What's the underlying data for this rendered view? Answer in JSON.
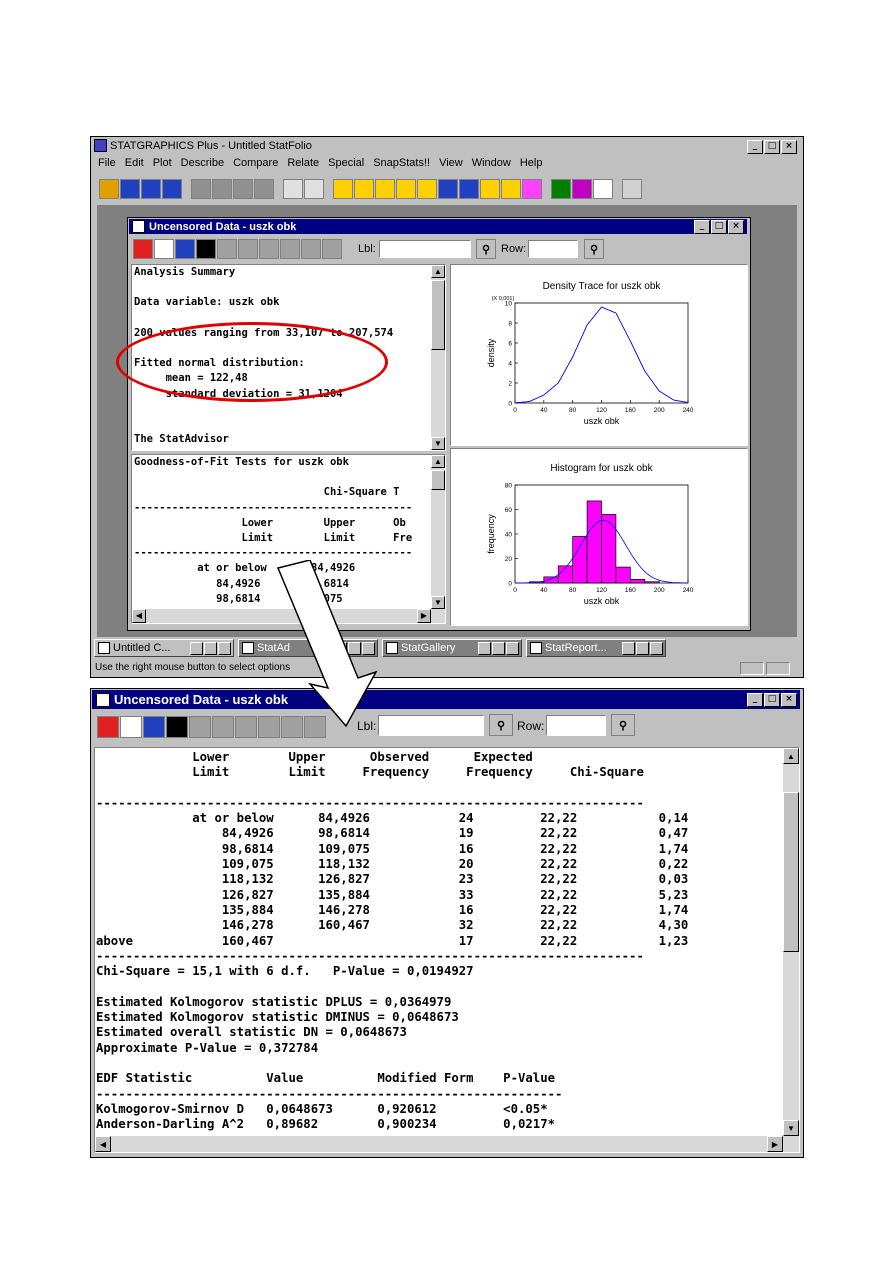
{
  "app": {
    "title": "STATGRAPHICS Plus - Untitled StatFolio",
    "menu": [
      "File",
      "Edit",
      "Plot",
      "Describe",
      "Compare",
      "Relate",
      "Special",
      "SnapStats!!",
      "View",
      "Window",
      "Help"
    ],
    "status": "Use the right mouse button to select options"
  },
  "inner_window": {
    "title": "Uncensored Data - uszk obk",
    "lbl": "Lbl:",
    "row": "Row:",
    "summary_lines": [
      "Analysis Summary",
      "",
      "Data variable: uszk obk",
      "",
      "200 values ranging from 33,107 to 207,574",
      "",
      "Fitted normal distribution:",
      "     mean = 122,48",
      "     standard deviation = 31,1204",
      "",
      "",
      "The StatAdvisor"
    ],
    "gof_lines": [
      "Goodness-of-Fit Tests for uszk obk",
      "",
      "                              Chi-Square T",
      "--------------------------------------------",
      "                 Lower        Upper      Ob",
      "                 Limit        Limit      Fre",
      "--------------------------------------------",
      "          at or below       84,4926",
      "             84,4926       98,6814",
      "             98,6814      109,075"
    ]
  },
  "density_chart": {
    "title": "Density Trace for uszk obk",
    "multiplier": "(X 0,001)",
    "xlabel": "uszk obk",
    "ylabel": "density",
    "xticks": [
      "0",
      "40",
      "80",
      "120",
      "160",
      "200",
      "240"
    ],
    "yticks": [
      "0",
      "2",
      "4",
      "6",
      "8",
      "10"
    ]
  },
  "histogram_chart": {
    "title": "Histogram for uszk obk",
    "xlabel": "uszk obk",
    "ylabel": "frequency",
    "xticks": [
      "0",
      "40",
      "80",
      "120",
      "160",
      "200",
      "240"
    ],
    "yticks": [
      "0",
      "20",
      "40",
      "60",
      "80"
    ]
  },
  "chart_data": [
    {
      "type": "line",
      "title": "Density Trace for uszk obk",
      "xlabel": "uszk obk",
      "ylabel": "density",
      "xlim": [
        0,
        240
      ],
      "ylim": [
        0,
        10
      ],
      "x": [
        0,
        20,
        40,
        60,
        80,
        100,
        120,
        140,
        160,
        180,
        200,
        220,
        240
      ],
      "values": [
        0.02,
        0.15,
        0.8,
        2.0,
        4.6,
        7.8,
        9.6,
        9.0,
        6.2,
        3.2,
        1.2,
        0.3,
        0.05
      ]
    },
    {
      "type": "bar",
      "title": "Histogram for uszk obk",
      "xlabel": "uszk obk",
      "ylabel": "frequency",
      "xlim": [
        0,
        240
      ],
      "ylim": [
        0,
        80
      ],
      "bin_edges": [
        20,
        40,
        60,
        80,
        100,
        120,
        140,
        160,
        180,
        200
      ],
      "values": [
        1,
        5,
        14,
        38,
        67,
        56,
        13,
        3,
        1
      ]
    }
  ],
  "taskbar": [
    {
      "label": "Untitled C...",
      "color": "#c0c0c0"
    },
    {
      "label": "StatAd",
      "color": "#808080"
    },
    {
      "label": "StatGallery",
      "color": "#808080"
    },
    {
      "label": "StatReport...",
      "color": "#808080"
    }
  ],
  "bottom_window": {
    "title": "Uncensored Data - uszk obk",
    "lbl": "Lbl:",
    "row": "Row:",
    "header_lines": [
      "             Lower        Upper      Observed      Expected",
      "             Limit        Limit     Frequency     Frequency     Chi-Square"
    ],
    "separator": "--------------------------------------------------------------------------",
    "rows": [
      [
        "",
        "at or below",
        "84,4926",
        "24",
        "22,22",
        "0,14"
      ],
      [
        "",
        "84,4926",
        "98,6814",
        "19",
        "22,22",
        "0,47"
      ],
      [
        "",
        "98,6814",
        "109,075",
        "16",
        "22,22",
        "1,74"
      ],
      [
        "",
        "109,075",
        "118,132",
        "20",
        "22,22",
        "0,22"
      ],
      [
        "",
        "118,132",
        "126,827",
        "23",
        "22,22",
        "0,03"
      ],
      [
        "",
        "126,827",
        "135,884",
        "33",
        "22,22",
        "5,23"
      ],
      [
        "",
        "135,884",
        "146,278",
        "16",
        "22,22",
        "1,74"
      ],
      [
        "",
        "146,278",
        "160,467",
        "32",
        "22,22",
        "4,30"
      ],
      [
        "above",
        "160,467",
        "",
        "17",
        "22,22",
        "1,23"
      ]
    ],
    "text_lines": [
      "Chi-Square = 15,1 with 6 d.f.   P-Value = 0,0194927",
      "",
      "Estimated Kolmogorov statistic DPLUS = 0,0364979",
      "Estimated Kolmogorov statistic DMINUS = 0,0648673",
      "Estimated overall statistic DN = 0,0648673",
      "Approximate P-Value = 0,372784",
      "",
      "EDF Statistic          Value          Modified Form    P-Value",
      "---------------------------------------------------------------",
      "Kolmogorov-Smirnov D   0,0648673      0,920612         <0.05*",
      "Anderson-Darling A^2   0,89682        0,900234         0,0217*"
    ]
  },
  "colors": {
    "titlebar": "#000080",
    "highlight_circle": "#e00000",
    "histogram_bar": "#ff00ff",
    "density_line": "#0000ff"
  }
}
